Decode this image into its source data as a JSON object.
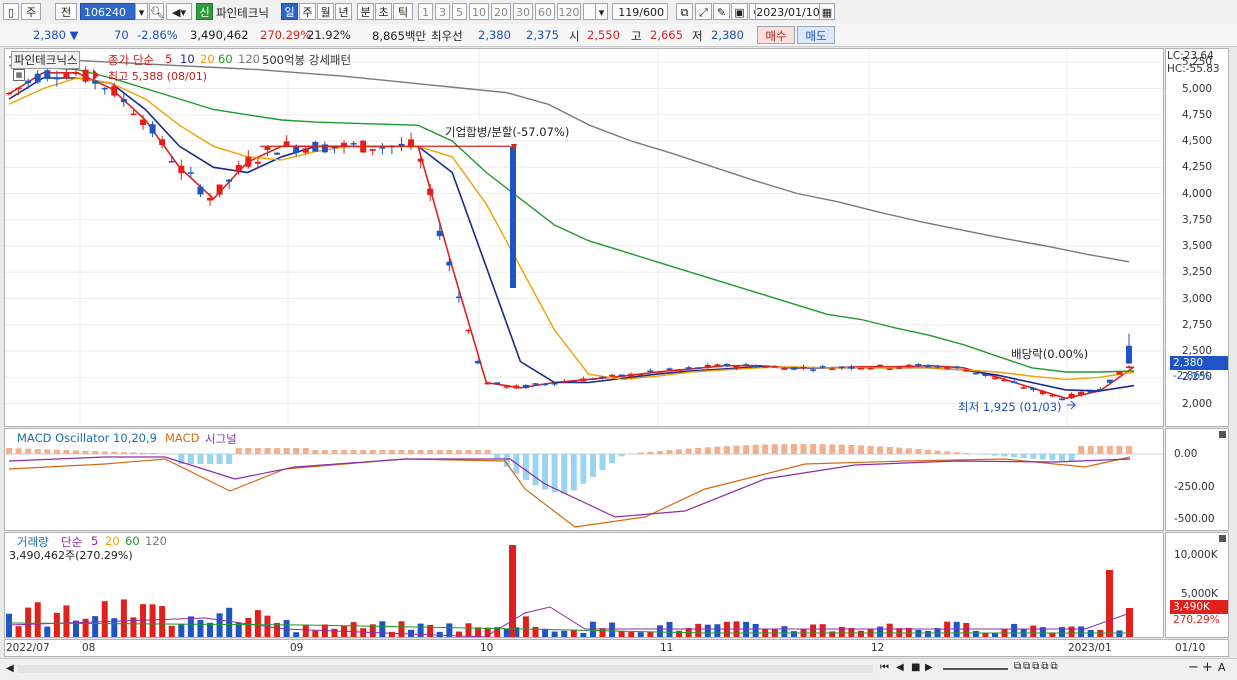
{
  "toolbar": {
    "period_selector": "주",
    "prev_label": "전",
    "stock_code": "106240",
    "new_badge": "신",
    "stock_name": "파인테크닉",
    "periods": [
      "일",
      "주",
      "월",
      "년",
      "분",
      "초",
      "틱"
    ],
    "active_period": "일",
    "intervals": [
      "1",
      "3",
      "5",
      "10",
      "20",
      "30",
      "60",
      "120"
    ],
    "count": "119/600",
    "date": "2023/01/10"
  },
  "quote": {
    "price": "2,380 ▼",
    "change": "70",
    "change_pct": "-2.86%",
    "volume": "3,490,462",
    "volume_ratio": "270.29%",
    "turnover": "21.92%",
    "amount": "8,865백만",
    "best_ask_label": "최우선",
    "best_ask": "2,380",
    "best_bid": "2,375",
    "open_label": "시",
    "open": "2,550",
    "high_label": "고",
    "high": "2,665",
    "low_label": "저",
    "low": "2,380",
    "buy_label": "매수",
    "sell_label": "매도"
  },
  "price_pane": {
    "tab_label": "파인테크닉스",
    "legend_series": "종가 단순",
    "legend_periods": [
      "5",
      "10",
      "20",
      "60",
      "120"
    ],
    "legend_extra": "500억봉 강세패턴",
    "lc": "LC:23.64",
    "hc": "HC:-55.83",
    "annotation_high": "최고 5,388 (08/01)",
    "annotation_split": "기업합병/분할(-57.07%)",
    "annotation_dividend": "배당락(0.00%)",
    "annotation_low": "최저 1,925 (01/03)",
    "price_tag": "2,380",
    "pct_tag": "-2.86%",
    "y_ticks": [
      "5,250",
      "5,000",
      "4,750",
      "4,500",
      "4,250",
      "4,000",
      "3,750",
      "3,500",
      "3,250",
      "3,000",
      "2,750",
      "2,500",
      "2,250",
      "2,000"
    ]
  },
  "macd_pane": {
    "legend_osc": "MACD Oscillator 10,20,9",
    "legend_macd": "MACD",
    "legend_signal": "시그널",
    "y_ticks": [
      "0.00",
      "-250.00",
      "-500.00"
    ]
  },
  "volume_pane": {
    "legend_title": "거래량",
    "legend_series": "단순",
    "legend_periods": [
      "5",
      "20",
      "60",
      "120"
    ],
    "volume_text": "3,490,462주(270.29%)",
    "y_ticks": [
      "10,000K",
      "5,000K"
    ],
    "vol_tag": "3,490K",
    "vol_pct_tag": "270.29%"
  },
  "x_axis": {
    "labels": [
      "2022/07",
      "08",
      "09",
      "10",
      "11",
      "12",
      "2023/01"
    ],
    "right_label": "01/10"
  },
  "colors": {
    "up": "#e0201b",
    "down": "#1d55c4",
    "ma5": "#e0201b",
    "ma10": "#1a2a8a",
    "ma20": "#f2a000",
    "ma60": "#1e9a2e",
    "ma120": "#7a7a7a",
    "osc_pos": "#f2b08f",
    "osc_neg": "#9bd4ef",
    "macd": "#d46a10",
    "signal": "#8a2ea8"
  },
  "chart_data": {
    "type": "candlestick",
    "price_range": [
      1900,
      5300
    ],
    "series": [
      {
        "name": "5",
        "values": [
          4950,
          5150,
          5150,
          5000,
          4700,
          4250,
          3950,
          4300,
          4450,
          4450,
          4450,
          4450,
          4450,
          3300,
          2200,
          2150,
          2200,
          2230,
          2260,
          2300,
          2330,
          2360,
          2360,
          2340,
          2340,
          2350,
          2350,
          2360,
          2340,
          2250,
          2150,
          2050,
          2120,
          2350
        ]
      },
      {
        "name": "10",
        "values": [
          4900,
          5100,
          5100,
          5050,
          4800,
          4450,
          4250,
          4200,
          4350,
          4450,
          4450,
          4450,
          4450,
          4200,
          3300,
          2400,
          2200,
          2200,
          2240,
          2280,
          2310,
          2330,
          2350,
          2340,
          2340,
          2340,
          2340,
          2340,
          2320,
          2270,
          2200,
          2130,
          2120,
          2170
        ]
      },
      {
        "name": "20",
        "values": [
          4850,
          5000,
          5100,
          5050,
          4900,
          4650,
          4450,
          4350,
          4320,
          4400,
          4450,
          4450,
          4450,
          4350,
          3900,
          3300,
          2700,
          2280,
          2230,
          2260,
          2300,
          2320,
          2340,
          2350,
          2340,
          2340,
          2340,
          2340,
          2320,
          2300,
          2260,
          2230,
          2250,
          2300
        ]
      },
      {
        "name": "60",
        "values": [
          5220,
          5200,
          5180,
          5100,
          5000,
          4900,
          4800,
          4750,
          4700,
          4680,
          4670,
          4660,
          4650,
          4500,
          4200,
          3950,
          3700,
          3550,
          3450,
          3350,
          3250,
          3150,
          3050,
          2950,
          2850,
          2800,
          2720,
          2650,
          2560,
          2450,
          2340,
          2300,
          2300,
          2310
        ]
      },
      {
        "name": "120",
        "values": [
          5300,
          5280,
          5260,
          5240,
          5220,
          5200,
          5180,
          5150,
          5120,
          5080,
          5040,
          5000,
          4960,
          4850,
          4650,
          4500,
          4380,
          4250,
          4120,
          4000,
          3920,
          3820,
          3730,
          3650,
          3570,
          3500,
          3420,
          3350
        ]
      }
    ],
    "high_marker": {
      "date": "08/01",
      "value": 5388
    },
    "low_marker": {
      "date": "01/03",
      "value": 1925
    },
    "last": {
      "open": 2550,
      "high": 2665,
      "low": 2380,
      "close": 2380
    }
  }
}
